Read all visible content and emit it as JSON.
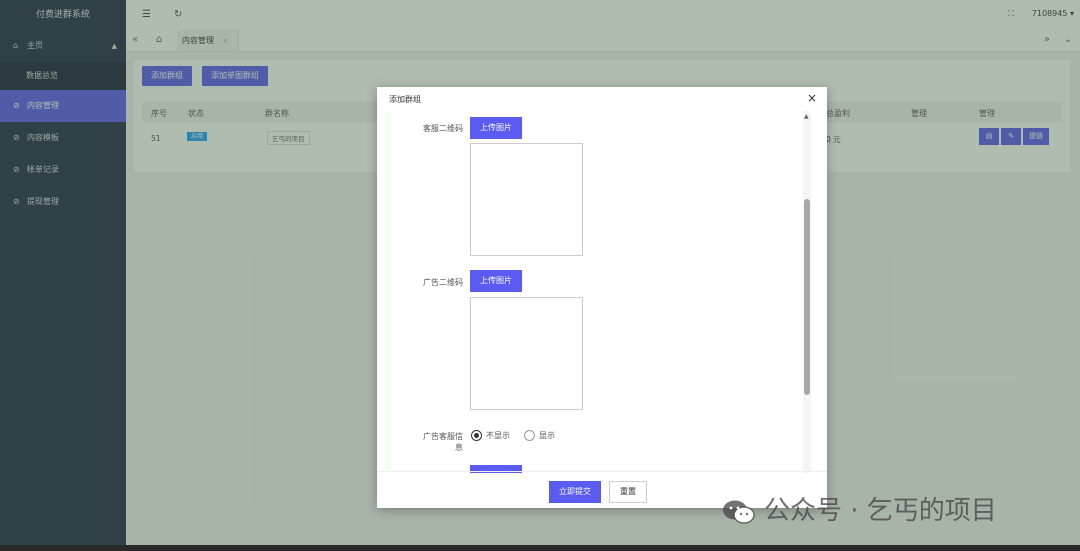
{
  "app": {
    "title": "付费进群系统"
  },
  "sidebar": {
    "items": [
      {
        "label": "主页"
      },
      {
        "label": "数据总览"
      },
      {
        "label": "内容管理"
      },
      {
        "label": "内容模板"
      },
      {
        "label": "帐单记录"
      },
      {
        "label": "提现管理"
      }
    ]
  },
  "topbar": {
    "user": "7108945"
  },
  "tabs": [
    {
      "label": "内容管理"
    }
  ],
  "toolbar": {
    "add_group": "添加群组",
    "add_single": "添加单图群组"
  },
  "table": {
    "headers": [
      "序号",
      "状态",
      "群名称",
      "总盈利",
      "管理",
      "管理"
    ],
    "rows": [
      {
        "id": "51",
        "status": "启用",
        "name": "乞丐的项目",
        "profit": "0 元",
        "action": "提链"
      }
    ]
  },
  "modal": {
    "title": "添加群组",
    "fields": {
      "service_qr_label": "客服二维码",
      "ad_qr_label": "广告二维码",
      "ad_info_label_1": "广告客服信",
      "ad_info_label_2": "息",
      "upload_label": "上传图片"
    },
    "radio": {
      "hide": "不显示",
      "show": "显示",
      "selected": "不显示"
    },
    "submit": "立即提交",
    "reset": "重置"
  },
  "watermark": {
    "text": "公众号 · 乞丐的项目"
  },
  "colors": {
    "accent": "#5b5bf2",
    "sidebar": "#1f2a48",
    "status": "#1e9fff"
  }
}
